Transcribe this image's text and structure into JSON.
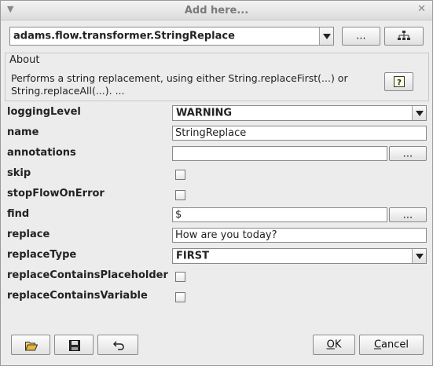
{
  "window": {
    "title": "Add here..."
  },
  "header": {
    "class_name": "adams.flow.transformer.StringReplace",
    "more_label": "..."
  },
  "about": {
    "heading": "About",
    "description": "Performs a string replacement, using either String.replaceFirst(...) or String.replaceAll(...). ..."
  },
  "properties": {
    "loggingLevel": {
      "label": "loggingLevel",
      "value": "WARNING"
    },
    "name": {
      "label": "name",
      "value": "StringReplace"
    },
    "annotations": {
      "label": "annotations",
      "value": "",
      "more_label": "..."
    },
    "skip": {
      "label": "skip",
      "checked": false
    },
    "stopFlowOnError": {
      "label": "stopFlowOnError",
      "checked": false
    },
    "find": {
      "label": "find",
      "value": "$",
      "more_label": "..."
    },
    "replace": {
      "label": "replace",
      "value": "How are you today?"
    },
    "replaceType": {
      "label": "replaceType",
      "value": "FIRST"
    },
    "replaceContainsPlaceholder": {
      "label": "replaceContainsPlaceholder",
      "checked": false
    },
    "replaceContainsVariable": {
      "label": "replaceContainsVariable",
      "checked": false
    }
  },
  "footer": {
    "ok_label": "OK",
    "ok_mnemonic": "O",
    "ok_rest": "K",
    "cancel_label": "Cancel",
    "cancel_mnemonic": "C",
    "cancel_rest": "ancel"
  }
}
